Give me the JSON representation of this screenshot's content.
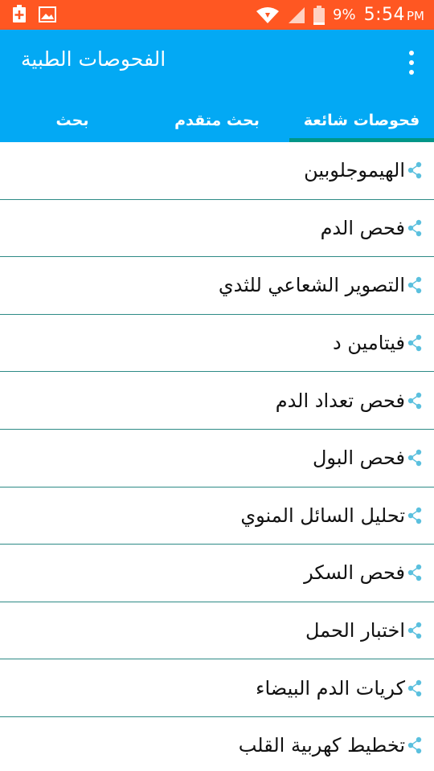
{
  "status_bar": {
    "battery_percent": "9%",
    "time": "5:54",
    "ampm": "PM",
    "color": "#ff5722"
  },
  "app_bar": {
    "title": "الفحوصات الطبية",
    "color": "#03a9f4",
    "tabs": [
      {
        "label": "فحوصات شائعة",
        "active": true
      },
      {
        "label": "بحث متقدم",
        "active": false
      },
      {
        "label": "بحث",
        "active": false
      }
    ],
    "indicator_color": "#009688"
  },
  "list": {
    "items": [
      {
        "label": "الهيموجلوبين",
        "icon": "share-icon"
      },
      {
        "label": "فحص الدم",
        "icon": "share-icon"
      },
      {
        "label": "التصوير الشعاعي للثدي",
        "icon": "share-icon"
      },
      {
        "label": "فيتامين د",
        "icon": "share-icon"
      },
      {
        "label": "فحص تعداد الدم",
        "icon": "share-icon"
      },
      {
        "label": "فحص البول",
        "icon": "share-icon"
      },
      {
        "label": "تحليل السائل المنوي",
        "icon": "share-icon"
      },
      {
        "label": "فحص السكر",
        "icon": "share-icon"
      },
      {
        "label": "اختبار الحمل",
        "icon": "share-icon"
      },
      {
        "label": "كريات الدم البيضاء",
        "icon": "share-icon"
      },
      {
        "label": "تخطيط كهربية القلب",
        "icon": "share-icon"
      }
    ],
    "divider_color": "#2d8a86",
    "icon_color": "#5bc0de"
  }
}
